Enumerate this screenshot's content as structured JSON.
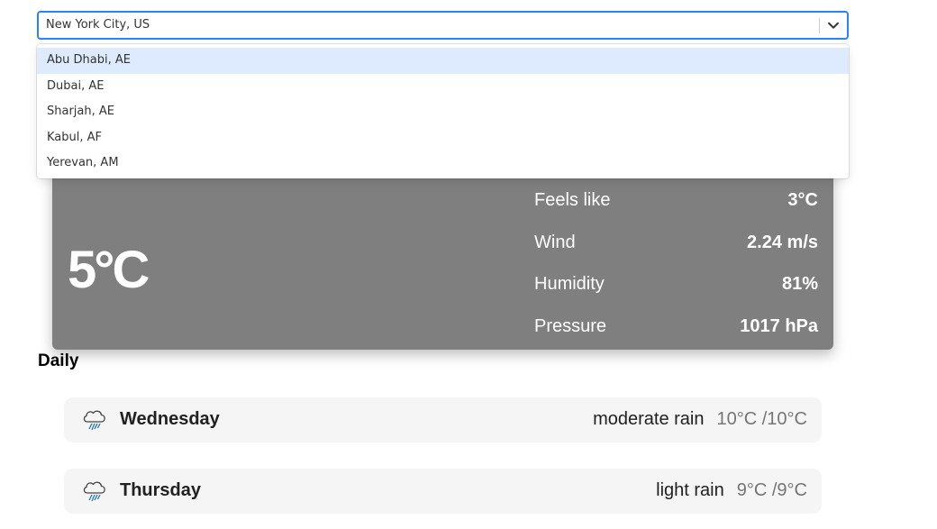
{
  "search": {
    "selected_value": "New York City, US"
  },
  "dropdown": {
    "options": [
      {
        "label": "Abu Dhabi, AE"
      },
      {
        "label": "Dubai, AE"
      },
      {
        "label": "Sharjah, AE"
      },
      {
        "label": "Kabul, AF"
      },
      {
        "label": "Yerevan, AM"
      }
    ]
  },
  "current": {
    "temperature": "5°C",
    "details": [
      {
        "label": "Feels like",
        "value": "3°C"
      },
      {
        "label": "Wind",
        "value": "2.24 m/s"
      },
      {
        "label": "Humidity",
        "value": "81%"
      },
      {
        "label": "Pressure",
        "value": "1017 hPa"
      }
    ],
    "card_color": "#7f7f7f"
  },
  "daily": {
    "title": "Daily",
    "days": [
      {
        "day": "Wednesday",
        "description": "moderate rain",
        "minmax": "10°C /10°C",
        "icon": "rain-cloud-icon"
      },
      {
        "day": "Thursday",
        "description": "light rain",
        "minmax": "9°C /9°C",
        "icon": "rain-cloud-icon"
      }
    ]
  },
  "colors": {
    "focus_border": "#2684ff",
    "option_highlight": "#deebff",
    "row_background": "#f5f5f5"
  }
}
